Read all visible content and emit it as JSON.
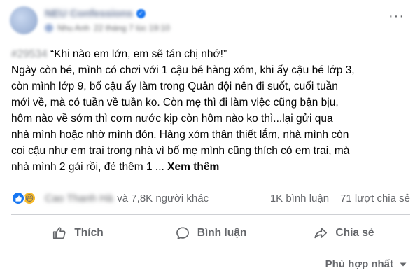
{
  "header": {
    "page_name": "NEU Confessions",
    "sub_name": "Nhu Anh",
    "timestamp": "22 tháng 7 lúc 19:10"
  },
  "post": {
    "code": "#29534",
    "line_1": "“Khi nào em lớn, em sẽ tán chị nhớ!”",
    "line_2": "Ngày còn bé, mình có chơi với 1 cậu bé hàng xóm, khi ấy cậu bé lớp 3,",
    "line_3": "còn mình lớp 9, bố cậu ấy làm trong Quân đội nên đi suốt, cuối tuần",
    "line_4": "mới về, mà có tuần về tuần ko. Còn mẹ thì đi làm việc cũng bận bịu,",
    "line_5": "hôm nào về sớm thì cơm nước kịp còn hôm nào ko thì...lại gửi qua",
    "line_6": "nhà mình hoặc nhờ mình đón. Hàng xóm thân thiết lắm, nhà mình còn",
    "line_7": "coi cậu như em trai trong nhà vì bố mẹ mình cũng thích có em trai, mà",
    "line_8": "nhà mình 2 gái rồi, đẻ thêm 1 ...",
    "see_more": "Xem thêm"
  },
  "reactions": {
    "reactor_name": "Cao Thanh Hà",
    "others": "và 7,8K người khác",
    "comments": "1K bình luận",
    "shares": "71 lượt chia sẻ"
  },
  "actions": {
    "like": "Thích",
    "comment": "Bình luận",
    "share": "Chia sẻ"
  },
  "sort": {
    "label": "Phù hợp nhất"
  },
  "colors": {
    "like_blue": "#1877f2",
    "haha_yellow": "#f7b928",
    "secondary_text": "#65676b"
  }
}
